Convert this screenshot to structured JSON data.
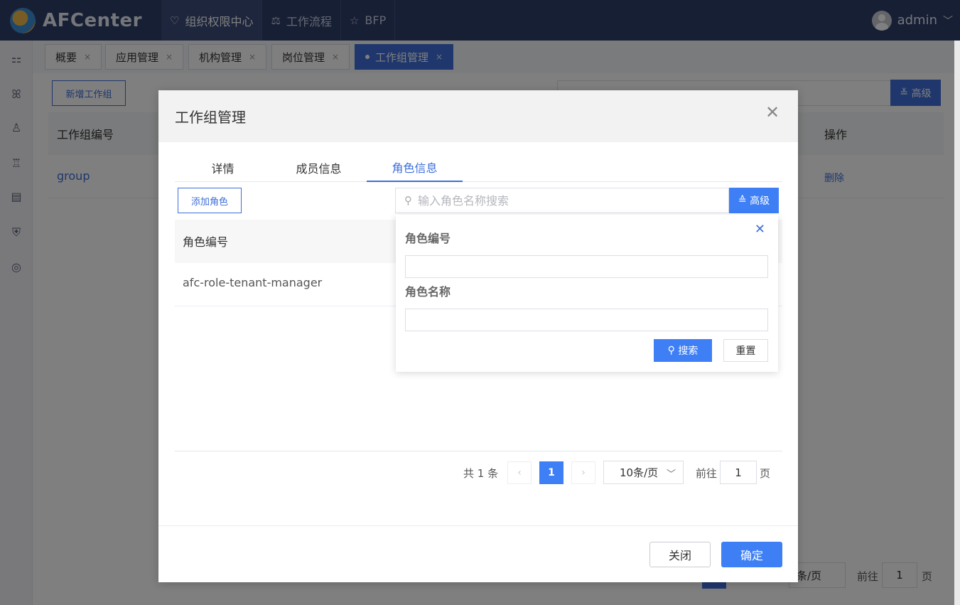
{
  "app": {
    "logo_text": "AFCenter"
  },
  "topnav": [
    {
      "icon": "heart-shield-icon",
      "label": "组织权限中心",
      "active": true
    },
    {
      "icon": "scale-icon",
      "label": "工作流程",
      "active": false
    },
    {
      "icon": "star-icon",
      "label": "BFP",
      "active": false
    }
  ],
  "user": {
    "name": "admin"
  },
  "page_tabs": [
    {
      "label": "概要"
    },
    {
      "label": "应用管理"
    },
    {
      "label": "机构管理"
    },
    {
      "label": "岗位管理"
    },
    {
      "label": "工作组管理"
    }
  ],
  "background": {
    "add_button": "新增工作组",
    "adv_button": "高级",
    "col_code": "工作组编号",
    "col_ops": "操作",
    "row_code": "group",
    "row_delete": "删除",
    "pager_size": "条/页",
    "pager_goto": "前往",
    "pager_page_value": "1",
    "pager_page_unit": "页"
  },
  "dialog": {
    "title": "工作组管理",
    "tabs": [
      "详情",
      "成员信息",
      "角色信息"
    ],
    "active_tab": "角色信息",
    "add_role_button": "添加角色",
    "search_placeholder": "输入角色名称搜索",
    "adv_button": "高级",
    "table": {
      "col_code": "角色编号",
      "rows": [
        {
          "code": "afc-role-tenant-manager"
        }
      ]
    },
    "pager": {
      "total": "共 1 条",
      "current_page": "1",
      "page_size": "10条/页",
      "goto_label": "前往",
      "goto_value": "1",
      "page_unit": "页"
    },
    "close_button": "关闭",
    "ok_button": "确定"
  },
  "adv_panel": {
    "label_code": "角色编号",
    "label_name": "角色名称",
    "search_button": "搜索",
    "reset_button": "重置"
  }
}
